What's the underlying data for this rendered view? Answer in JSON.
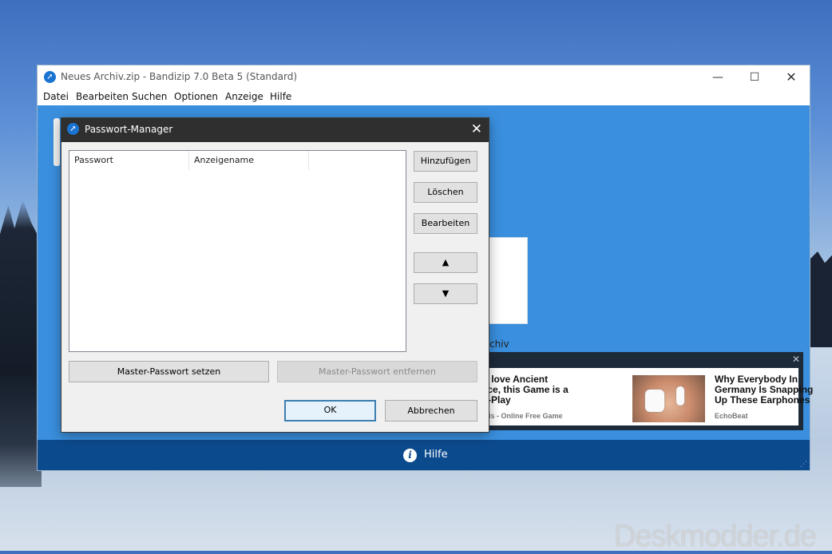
{
  "main_window": {
    "title": "Neues Archiv.zip - Bandizip 7.0 Beta 5 (Standard)",
    "controls": {
      "minimize": "—",
      "maximize": "☐",
      "close": "✕"
    },
    "menu": [
      "Datei",
      "Bearbeiten",
      "Suchen",
      "Optionen",
      "Anzeige",
      "Hilfe"
    ],
    "panel_text": "chiv",
    "status": {
      "help_label": "Hilfe"
    }
  },
  "ad": {
    "close": "✕",
    "left_text": "f You love Ancient Greece, this Game is a Must-Play",
    "left_source": "Grepolis - Online Free Game",
    "right_text": "Why Everybody In Germany Is Snapping Up These Earphones",
    "right_source": "EchoBeat"
  },
  "dialog": {
    "title": "Passwort-Manager",
    "close": "✕",
    "columns": [
      "Passwort",
      "Anzeigename"
    ],
    "buttons": {
      "add": "Hinzufügen",
      "delete": "Löschen",
      "edit": "Bearbeiten",
      "up": "▲",
      "down": "▼",
      "set_master": "Master-Passwort setzen",
      "remove_master": "Master-Passwort entfernen",
      "ok": "OK",
      "cancel": "Abbrechen"
    }
  },
  "watermark": "Deskmodder.de"
}
